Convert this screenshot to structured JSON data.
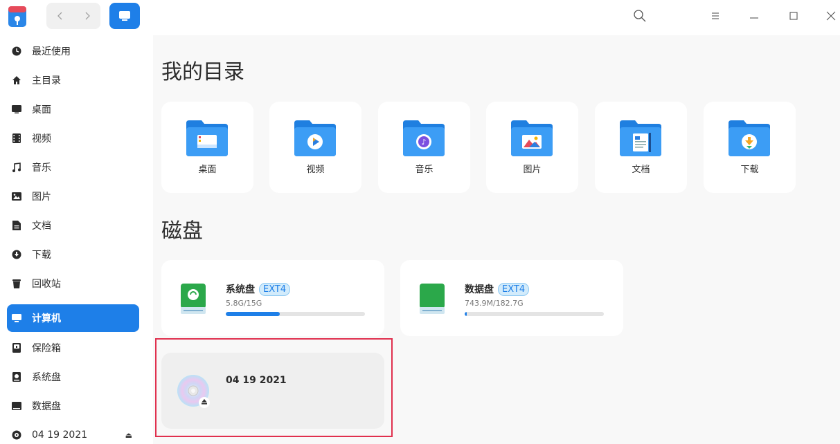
{
  "sidebar": {
    "items": [
      {
        "label": "最近使用",
        "icon": "clock-icon"
      },
      {
        "label": "主目录",
        "icon": "home-icon"
      },
      {
        "label": "桌面",
        "icon": "desktop-icon"
      },
      {
        "label": "视频",
        "icon": "video-icon"
      },
      {
        "label": "音乐",
        "icon": "music-icon"
      },
      {
        "label": "图片",
        "icon": "picture-icon"
      },
      {
        "label": "文档",
        "icon": "document-icon"
      },
      {
        "label": "下载",
        "icon": "download-icon"
      },
      {
        "label": "回收站",
        "icon": "trash-icon"
      },
      {
        "label": "计算机",
        "icon": "computer-icon",
        "active": true
      },
      {
        "label": "保险箱",
        "icon": "vault-icon"
      },
      {
        "label": "系统盘",
        "icon": "disk-icon"
      },
      {
        "label": "数据盘",
        "icon": "disk-icon"
      },
      {
        "label": "04 19 2021",
        "icon": "optical-disc-icon"
      }
    ]
  },
  "main": {
    "my_dirs_title": "我的目录",
    "dirs": [
      {
        "label": "桌面",
        "icon": "desktop-folder-icon"
      },
      {
        "label": "视频",
        "icon": "video-folder-icon"
      },
      {
        "label": "音乐",
        "icon": "music-folder-icon"
      },
      {
        "label": "图片",
        "icon": "picture-folder-icon"
      },
      {
        "label": "文档",
        "icon": "document-folder-icon"
      },
      {
        "label": "下载",
        "icon": "download-folder-icon"
      }
    ],
    "disks_title": "磁盘",
    "disks": [
      {
        "name": "系统盘",
        "fs": "EXT4",
        "usage": "5.8G/15G",
        "fraction": 0.387,
        "color": "#2ba84a"
      },
      {
        "name": "数据盘",
        "fs": "EXT4",
        "usage": "743.9M/182.7G",
        "fraction": 0.004,
        "color": "#2ba84a"
      }
    ],
    "optical": {
      "name": "04 19 2021"
    }
  },
  "colors": {
    "accent": "#1e7fe8",
    "highlight_border": "#e0304e",
    "folder_blue": "#2b8ff0"
  }
}
